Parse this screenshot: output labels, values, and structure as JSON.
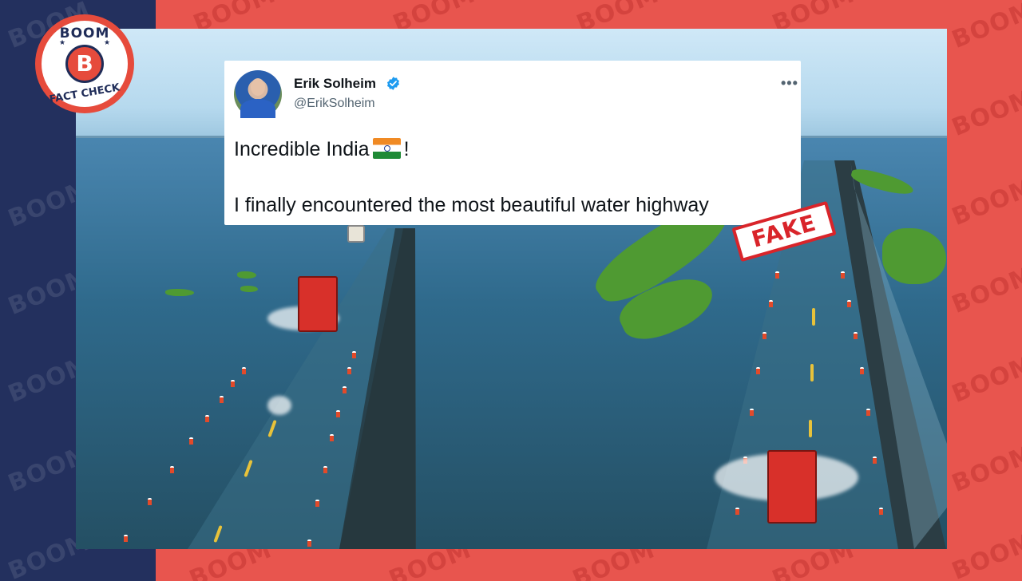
{
  "watermark_text": "BOOM",
  "logo": {
    "top_text": "BOOM",
    "letter": "B",
    "bottom_text": "FACT CHECK"
  },
  "tweet": {
    "author_name": "Erik Solheim",
    "author_handle": "@ErikSolheim",
    "more_icon": "more-options-icon",
    "line1_before_flag": "Incredible India",
    "line1_after_flag": "!",
    "line2": "I finally encountered the most beautiful water highway"
  },
  "stamp": {
    "label": "FAKE"
  },
  "colors": {
    "brand_red": "#e8554e",
    "brand_navy": "#23305e",
    "stamp_red": "#d9242a",
    "verified_blue": "#1d9bf0"
  }
}
